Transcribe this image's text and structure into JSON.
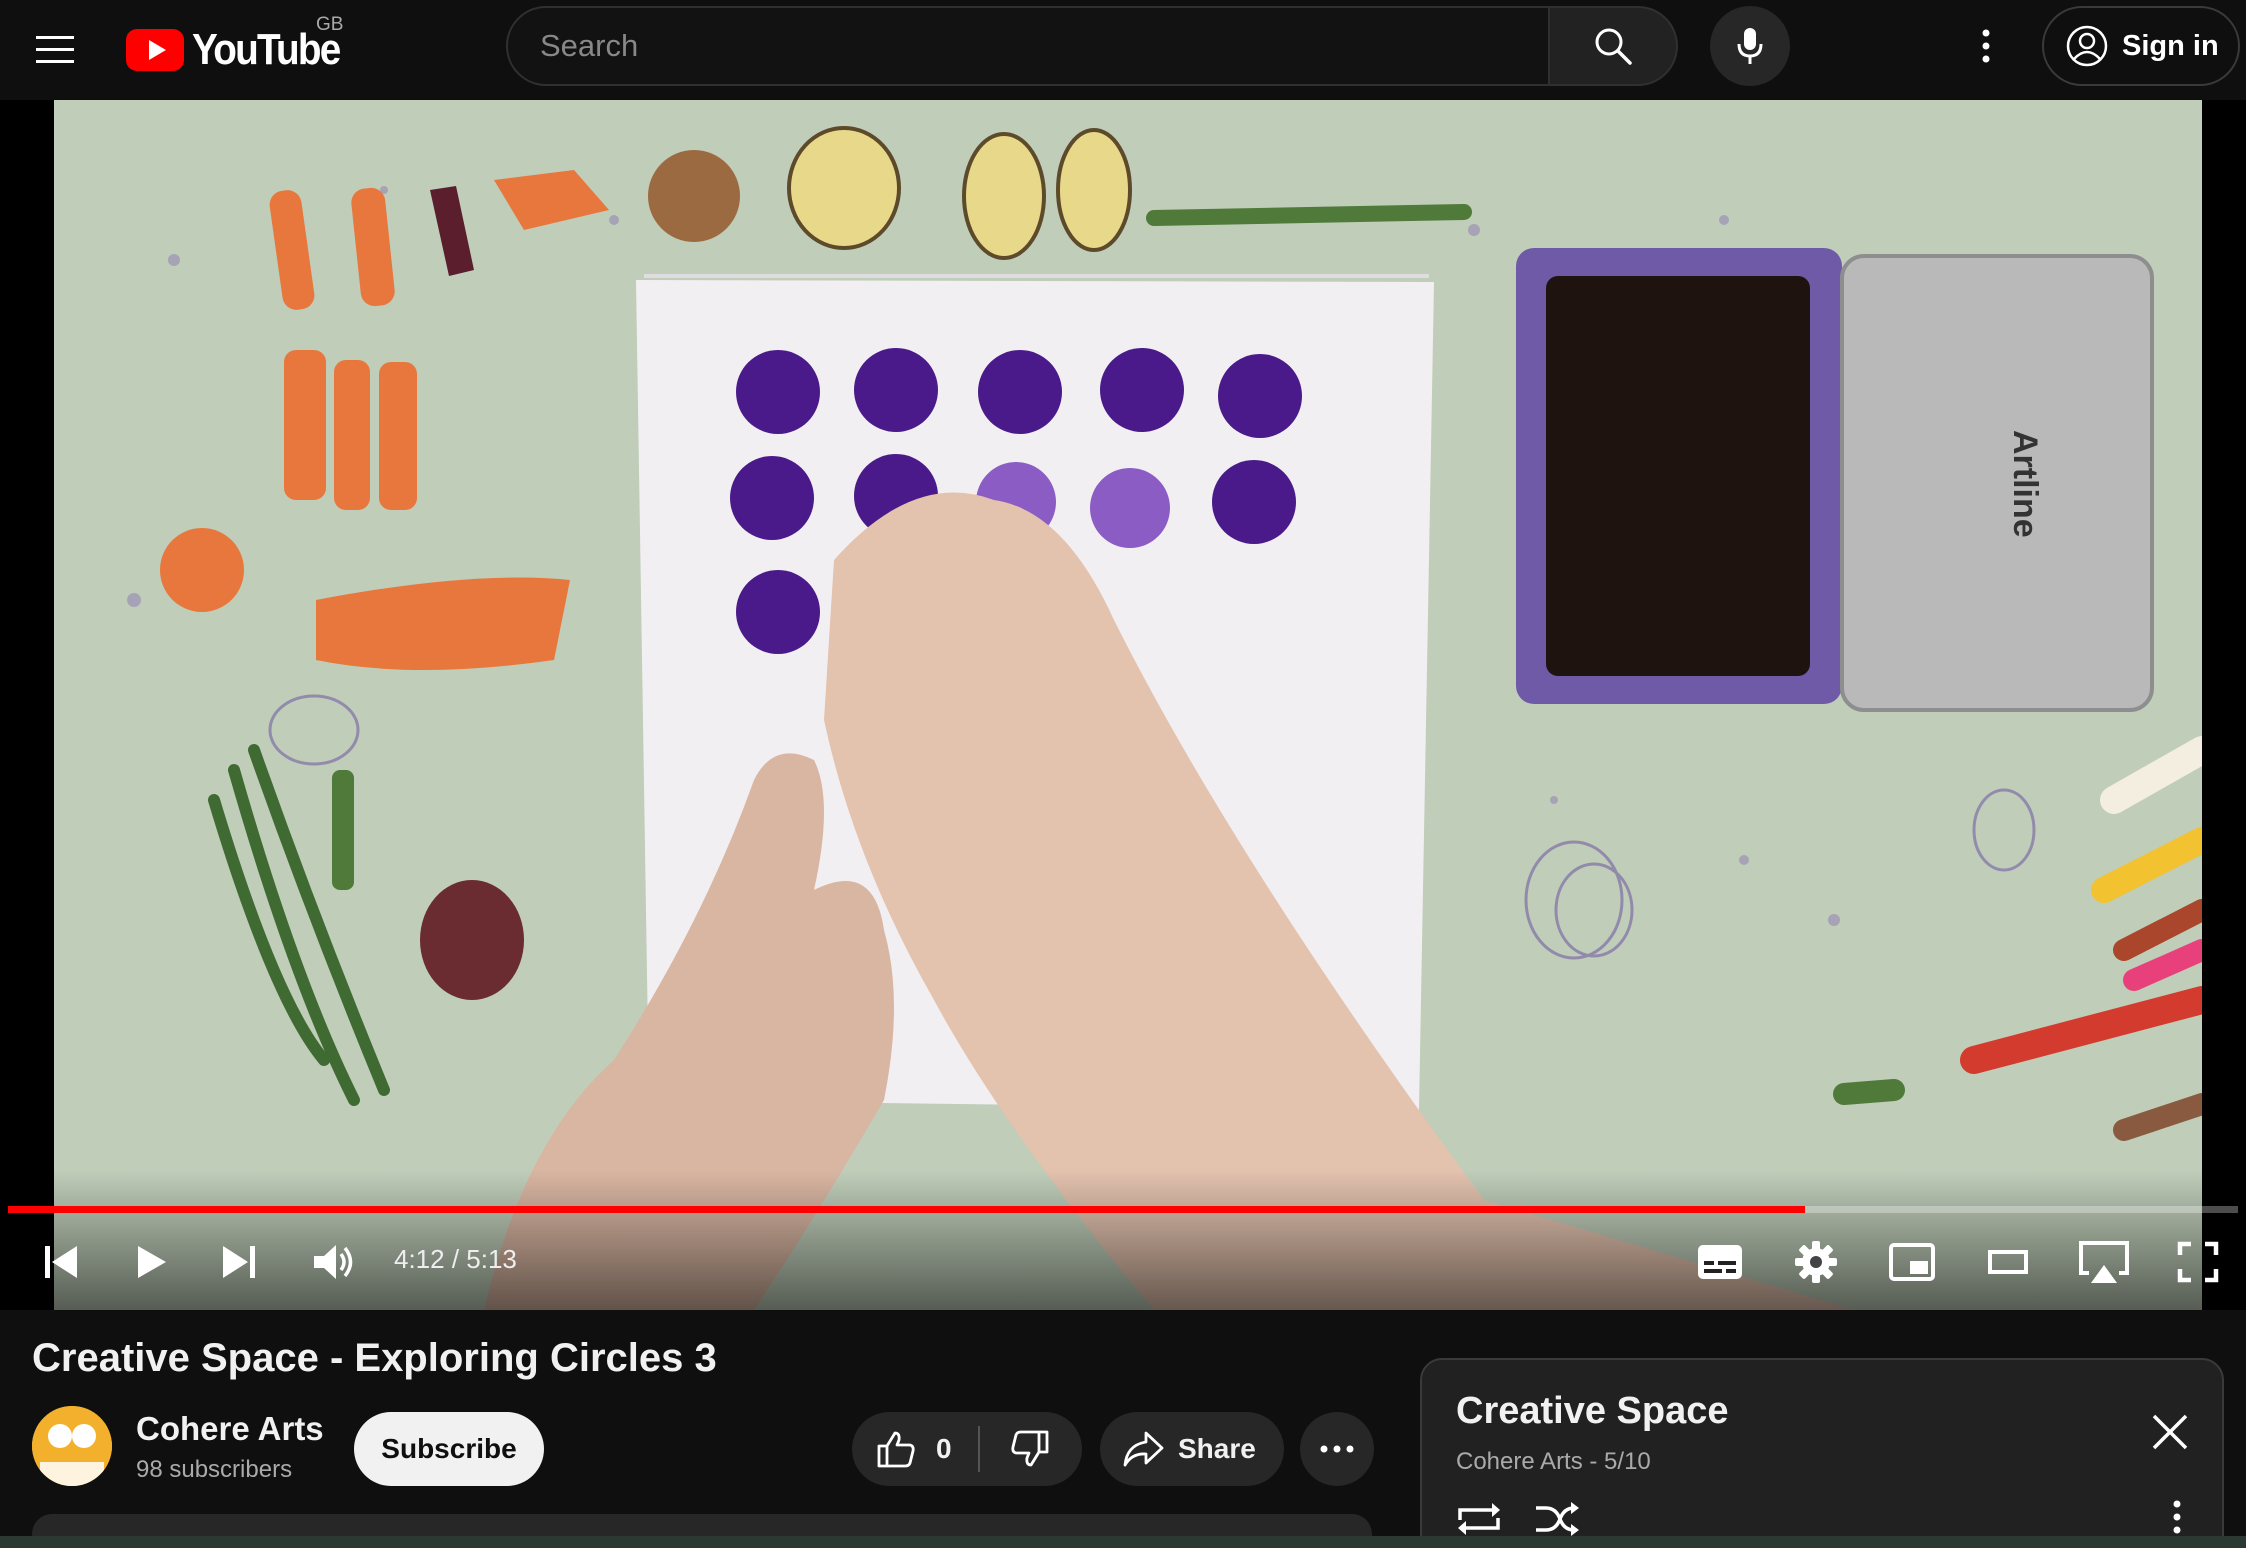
{
  "masthead": {
    "logo_text": "YouTube",
    "country_code": "GB",
    "search_placeholder": "Search",
    "sign_in_label": "Sign in"
  },
  "player": {
    "current_time": "4:12",
    "duration": "5:13",
    "time_display": "4:12 / 5:13",
    "progress_fraction": 0.806,
    "accent_color": "#ff0000",
    "controls": [
      "previous-icon",
      "play-icon",
      "next-icon",
      "volume-icon",
      "subtitles-icon",
      "settings-icon",
      "miniplayer-icon",
      "theater-mode-icon",
      "airplay-icon",
      "fullscreen-icon"
    ]
  },
  "video": {
    "title": "Creative Space - Exploring Circles 3",
    "channel_name": "Cohere Arts",
    "subscribers": "98 subscribers",
    "subscribe_label": "Subscribe",
    "like_count": "0",
    "share_label": "Share"
  },
  "playlist": {
    "title": "Creative Space",
    "subtitle": "Cohere Arts - 5/10"
  }
}
